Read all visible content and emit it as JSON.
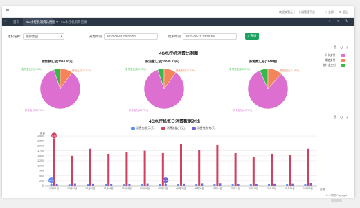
{
  "header": {
    "right_items": [
      "欢迎来到云十一卡通管理平台",
      "全屏",
      "退出"
    ]
  },
  "tabs": [
    {
      "label": "首页",
      "active": false
    },
    {
      "label": "4G水控机消费比例图",
      "active": true
    },
    {
      "label": "4G水控机消费记录",
      "active": false
    }
  ],
  "filters": {
    "org_label": "组织名称:",
    "org_value": "德邦集团",
    "start_label": "开始时间:",
    "start_value": "2020-08-01 00:00:00",
    "end_label": "结束时间:",
    "end_value": "2020-08-15 23:59:59",
    "search_label": "查询"
  },
  "pie_section": {
    "title": "4G水控机消费比例图",
    "legend": [
      {
        "name": "扣卡支付",
        "color": "#dc6fd0"
      },
      {
        "name": "微信支付",
        "color": "#f4845a"
      },
      {
        "name": "支付宝支付",
        "color": "#36b948"
      }
    ],
    "pies": [
      {
        "title": "按金额汇总(1064.92元)",
        "label_green": "支付宝支付(5.29%)",
        "label_orange": "微信支付(10.01%)",
        "label_pink": "扣卡支付(84.70%)"
      },
      {
        "title": "按流量汇总(30045.53升)",
        "label_green": "支付宝支付(5.27%)",
        "label_orange": "微信支付(10.02%)",
        "label_pink": "扣卡支付(84.71%)"
      },
      {
        "title": "按笔数汇总(1848笔)",
        "label_green": "支付宝支付(6.72%)",
        "label_orange": "微信支付(11.58%)",
        "label_pink": "扣卡支付(81.70%)"
      }
    ]
  },
  "chart_data": {
    "type": "bar",
    "title": "4G水控机每日消费数据对比",
    "ylabel": "数量",
    "xlabel": "日期",
    "ylim": [
      0,
      2500
    ],
    "yticks": [
      0,
      250,
      500,
      750,
      1000,
      1250,
      1500,
      1750,
      2000,
      2250,
      2500
    ],
    "grid": true,
    "legend_position": "top-center",
    "categories": [
      "08月01日",
      "08月02日",
      "08月03日",
      "08月04日",
      "08月05日",
      "08月06日",
      "08月07日",
      "08月08日",
      "08月09日",
      "08月10日",
      "08月11日",
      "08月12日",
      "08月13日",
      "08月14日",
      "08月15日"
    ],
    "series": [
      {
        "name": "消费金额(元/天)",
        "color": "#5b8ff9",
        "values": [
          100,
          60,
          75,
          70,
          65,
          75,
          70,
          70,
          90,
          80,
          75,
          70,
          70,
          75,
          80
        ]
      },
      {
        "name": "消费流量(升/天)",
        "color": "#d1405f",
        "values": [
          2350,
          1500,
          1850,
          1600,
          1700,
          1750,
          1650,
          2100,
          1800,
          2050,
          1650,
          1450,
          1600,
          1550,
          1850
        ]
      },
      {
        "name": "消费笔数(笔/天)",
        "color": "#7063d8",
        "values": [
          80,
          120,
          110,
          95,
          105,
          120,
          100,
          110,
          125,
          130,
          100,
          95,
          110,
          115,
          140
        ]
      }
    ],
    "annotations": [
      "2,350",
      "11.07",
      "20.44"
    ]
  },
  "footer": {
    "copyright": "© 卡嘻嘻 Copyright"
  }
}
